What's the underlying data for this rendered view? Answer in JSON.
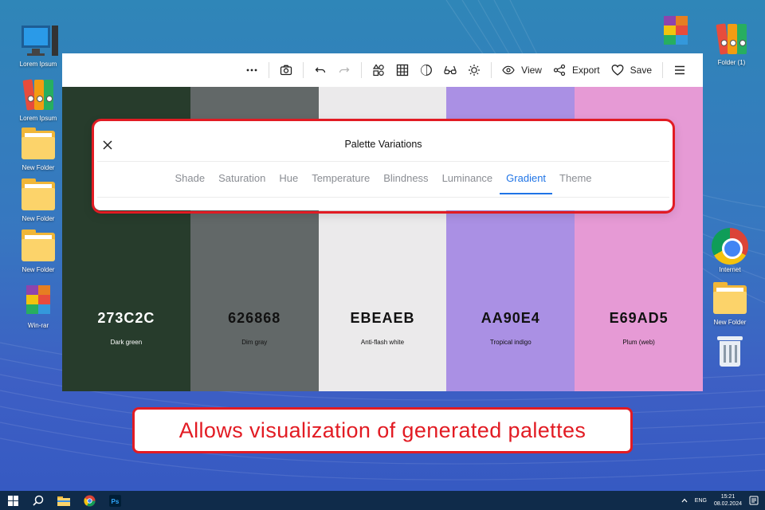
{
  "desktop": {
    "left_icons": [
      {
        "label": "Lorem Ipsum",
        "icon": "computer-icon"
      },
      {
        "label": "Lorem Ipsum",
        "icon": "binders-icon"
      },
      {
        "label": "New Folder",
        "icon": "folder-icon"
      },
      {
        "label": "New Folder",
        "icon": "folder-icon"
      },
      {
        "label": "New Folder",
        "icon": "folder-icon"
      },
      {
        "label": "Win-rar",
        "icon": "winrar-icon"
      }
    ],
    "right_icons": [
      {
        "label": "",
        "icon": "winrar-icon"
      },
      {
        "label": "Folder (1)",
        "icon": "binders-icon"
      },
      {
        "label": "Internet",
        "icon": "chrome-icon"
      },
      {
        "label": "New Folder",
        "icon": "folder-icon"
      },
      {
        "label": "",
        "icon": "recycle-bin-icon"
      }
    ]
  },
  "toolbar": {
    "more_icon": "more-dots-icon",
    "camera_icon": "camera-icon",
    "undo_icon": "undo-icon",
    "redo_icon": "redo-icon",
    "shapes_icon": "shapes-icon",
    "grid_icon": "grid-icon",
    "contrast_icon": "contrast-icon",
    "glasses_icon": "glasses-icon",
    "brightness_icon": "brightness-icon",
    "view_label": "View",
    "export_label": "Export",
    "save_label": "Save",
    "menu_icon": "hamburger-icon"
  },
  "palette": [
    {
      "hex": "273C2C",
      "name": "Dark green",
      "color": "#273C2C",
      "text_color": "#ffffff"
    },
    {
      "hex": "626868",
      "name": "Dim gray",
      "color": "#626868",
      "text_color": "#111111"
    },
    {
      "hex": "EBEAEB",
      "name": "Anti-flash white",
      "color": "#EBEAEB",
      "text_color": "#111111"
    },
    {
      "hex": "AA90E4",
      "name": "Tropical indigo",
      "color": "#AA90E4",
      "text_color": "#111111"
    },
    {
      "hex": "E69AD5",
      "name": "Plum (web)",
      "color": "#E69AD5",
      "text_color": "#111111"
    }
  ],
  "modal": {
    "title": "Palette Variations",
    "tabs": [
      "Shade",
      "Saturation",
      "Hue",
      "Temperature",
      "Blindness",
      "Luminance",
      "Gradient",
      "Theme"
    ],
    "active_tab": "Gradient"
  },
  "caption": "Allows visualization of generated palettes",
  "taskbar": {
    "language": "ENG",
    "time": "15:21",
    "date": "08.02.2024"
  },
  "colors": {
    "accent_blue": "#1f74e6",
    "highlight_red": "#e21b23",
    "taskbar": "#0f2b4a"
  }
}
